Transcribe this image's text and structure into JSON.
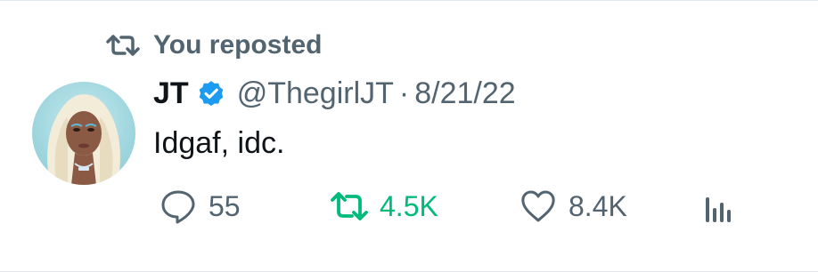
{
  "repost_header": {
    "label": "You reposted"
  },
  "tweet": {
    "author_name": "JT",
    "handle": "@ThegirlJT",
    "separator": "·",
    "date": "8/21/22",
    "text": "Idgaf, idc."
  },
  "actions": {
    "replies": "55",
    "reposts": "4.5K",
    "likes": "8.4K"
  },
  "colors": {
    "verified": "#1d9bf0",
    "repost_active": "#00ba7c",
    "muted": "#536471",
    "text": "#0f1419"
  }
}
